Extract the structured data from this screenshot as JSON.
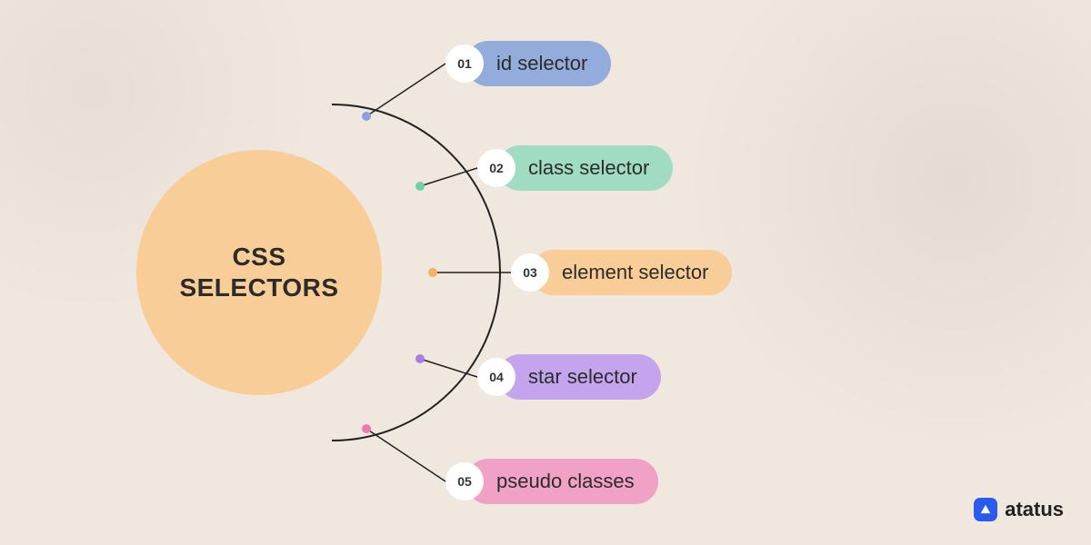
{
  "title": "CSS\nSELECTORS",
  "items": [
    {
      "num": "01",
      "label": "id selector",
      "color": "#93acdc",
      "dot": "#8a9fe0"
    },
    {
      "num": "02",
      "label": "class selector",
      "color": "#9fdcc1",
      "dot": "#6fd2a0"
    },
    {
      "num": "03",
      "label": "element selector",
      "color": "#f8cd97",
      "dot": "#f3b25f"
    },
    {
      "num": "04",
      "label": "star selector",
      "color": "#c4a4ec",
      "dot": "#a97ee4"
    },
    {
      "num": "05",
      "label": "pseudo classes",
      "color": "#f2a1c6",
      "dot": "#ed7ab0"
    }
  ],
  "brand": "atatus"
}
